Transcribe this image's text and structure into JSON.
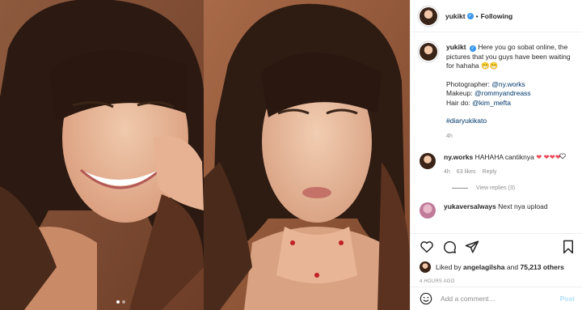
{
  "header": {
    "username": "yukikt",
    "verified_icon": "verified-badge-icon",
    "separator": "•",
    "follow_status": "Following"
  },
  "caption": {
    "username": "yukikt",
    "text": "Here you go sobat online, the pictures that you guys have been waiting for hahaha 😁😁",
    "photographer_label": "Photographer:",
    "photographer_handle": "@ny.works",
    "makeup_label": "Makeup:",
    "makeup_handle": "@rommyandreass",
    "hair_label": "Hair do:",
    "hair_handle": "@kim_mefta",
    "hashtag": "#diaryukikato",
    "time": "4h"
  },
  "comments": [
    {
      "username": "ny.works",
      "text": "HAHAHA cantiknya",
      "hearts": "❤ ❤❤❤",
      "time": "4h",
      "likes": "63 likes",
      "reply_label": "Reply",
      "view_replies": "View replies (3)"
    },
    {
      "username": "yukaversalways",
      "text": "Next nya upload"
    }
  ],
  "actions": {
    "like_icon": "heart-outline-icon",
    "comment_icon": "comment-icon",
    "share_icon": "send-icon",
    "save_icon": "bookmark-icon",
    "liked_by_prefix": "Liked by",
    "liked_by_user": "angelagilsha",
    "liked_by_and": "and",
    "liked_by_count": "75,213 others",
    "time_ago": "4 HOURS AGO"
  },
  "add_comment": {
    "placeholder": "Add a comment…",
    "post_label": "Post"
  },
  "colors": {
    "verified": "#3897f0",
    "link": "#00376b",
    "heart": "#ed4956",
    "post_disabled": "#b2dffc",
    "border": "#efefef"
  }
}
